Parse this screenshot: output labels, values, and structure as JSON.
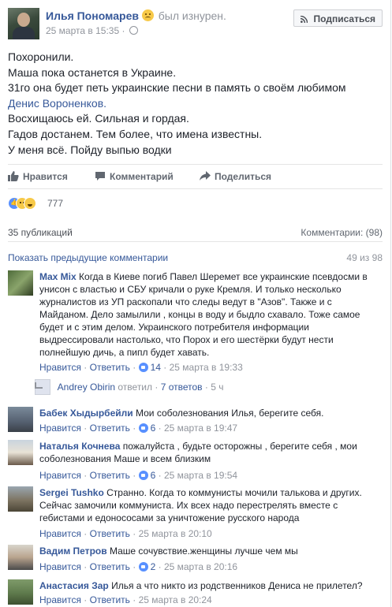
{
  "header": {
    "author": "Илья Пономарев",
    "feeling": "был изнурен.",
    "timestamp": "25 марта в 15:35 ·",
    "subscribe_label": "Подписаться"
  },
  "post": {
    "lines": [
      "Похоронили.",
      "Маша пока останется в Украине.",
      "31го она будет петь украинские песни в память о своём любимом",
      "Денис Вороненков.",
      "Восхищаюсь ей. Сильная и гордая.",
      "Гадов достанем. Тем более, что имена известны.",
      "У меня всё. Пойду выпью водки"
    ]
  },
  "actions": {
    "like": "Нравится",
    "comment": "Комментарий",
    "share": "Поделиться"
  },
  "reactions": {
    "count": "777"
  },
  "stats": {
    "shares": "35 публикаций",
    "comments": "Комментарии: (98)"
  },
  "previous": {
    "label": "Показать предыдущие комментарии",
    "count": "49 из 98"
  },
  "meta_labels": {
    "like": "Нравится",
    "reply": "Ответить"
  },
  "comments": [
    {
      "name": "Max Mix",
      "text": "Когда в Киеве погиб Павел Шеремет все украинские псевдосми в унисон с властью и СБУ кричали о руке Кремля. И только несколько журналистов из УП раскопали что следы ведут в \"Азов\". Также и с Майданом. Дело замылили , концы в воду и быдло схавало. Тоже самое будет и с этим делом. Украинского потребителя информации выдрессировали настолько, что Порох и его шестёрки будут нести полнейшую дичь, а пипл будет хавать.",
      "likes": "14",
      "time": "25 марта в 19:33"
    },
    {
      "name": "Бабек Хыдырбейли",
      "text": "Мои соболезнования Илья, берегите себя.",
      "likes": "6",
      "time": "25 марта в 19:47"
    },
    {
      "name": "Наталья Кочнева",
      "text": "пожалуйста , будьте осторожны , берегите себя , мои соболезнования Маше и всем близким",
      "likes": "6",
      "time": "25 марта в 19:54"
    },
    {
      "name": "Sergei Tushko",
      "text": "Странно. Когда то коммунисты мочили талькова и других. Сейчас замочили коммуниста. Их всех надо перестрелять вместе с гебистами и едонососами за уничтожение русского народа",
      "likes": "",
      "time": "25 марта в 20:10"
    },
    {
      "name": "Вадим Петров",
      "text": "Маше сочувствие.женщины лучше чем мы",
      "likes": "2",
      "time": "25 марта в 20:16"
    },
    {
      "name": "Анастасия Зар",
      "text": "Илья а что никто из родственников Дениса не прилетел?",
      "likes": "",
      "time": "25 марта в 20:24"
    }
  ],
  "reply": {
    "name": "Andrey Obirin",
    "verb": "ответил",
    "sep": "·",
    "count": "7 ответов",
    "time": "5 ч"
  },
  "colors": {
    "link": "#365899",
    "meta": "#90949c",
    "text": "#1d2129",
    "like_blue": "#5890ff"
  },
  "icons": [
    "globe-icon",
    "rss-icon",
    "thumbs-up-icon",
    "comment-icon",
    "share-icon",
    "like-reaction-icon",
    "sad-reaction-icon",
    "haha-reaction-icon",
    "reply-arrow-icon"
  ]
}
